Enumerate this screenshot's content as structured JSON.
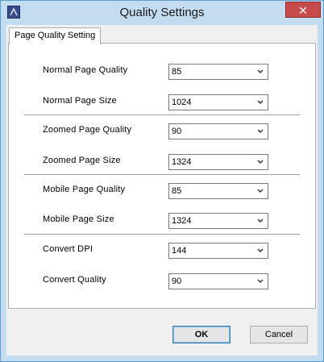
{
  "window": {
    "title": "Quality Settings",
    "close_glyph": "✕"
  },
  "tabs": [
    {
      "label": "Page Quality Setting"
    }
  ],
  "settings": [
    {
      "label": "Normal  Page  Quality",
      "value": "85"
    },
    {
      "label": "Normal  Page  Size",
      "value": "1024"
    },
    {
      "label": "Zoomed  Page  Quality",
      "value": "90"
    },
    {
      "label": "Zoomed  Page  Size",
      "value": "1324"
    },
    {
      "label": "Mobile  Page  Quality",
      "value": "85"
    },
    {
      "label": "Mobile  Page  Size",
      "value": "1324"
    },
    {
      "label": "Convert DPI",
      "value": "144"
    },
    {
      "label": "Convert Quality",
      "value": "90"
    }
  ],
  "buttons": {
    "ok": "OK",
    "cancel": "Cancel"
  },
  "colors": {
    "titlebar": "#c4dcf0",
    "close": "#c74b4b",
    "accent_border": "#3c7fb1"
  },
  "icons": {
    "app": "app-icon",
    "close": "close-icon",
    "dropdown": "chevron-down-icon"
  }
}
